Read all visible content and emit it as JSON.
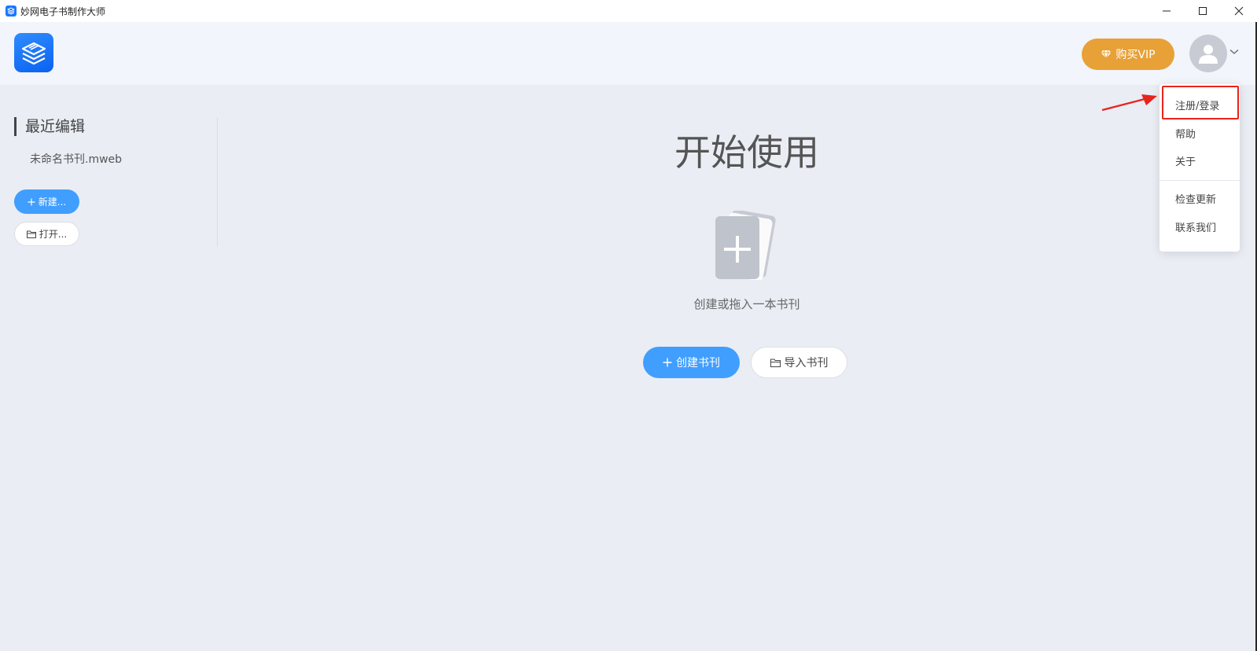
{
  "window": {
    "title": "妙网电子书制作大师"
  },
  "header": {
    "vip_label": "购买VIP"
  },
  "sidebar": {
    "heading": "最近编辑",
    "recent_files": [
      "未命名书刊.mweb"
    ],
    "new_label": "新建...",
    "open_label": "打开..."
  },
  "main": {
    "title": "开始使用",
    "hint": "创建或拖入一本书刊",
    "create_label": "创建书刊",
    "import_label": "导入书刊"
  },
  "user_menu": {
    "items": [
      "注册/登录",
      "帮助",
      "关于",
      "检查更新",
      "联系我们"
    ]
  },
  "colors": {
    "accent": "#409eff",
    "vip": "#e7a136",
    "highlight": "#e8231c"
  }
}
